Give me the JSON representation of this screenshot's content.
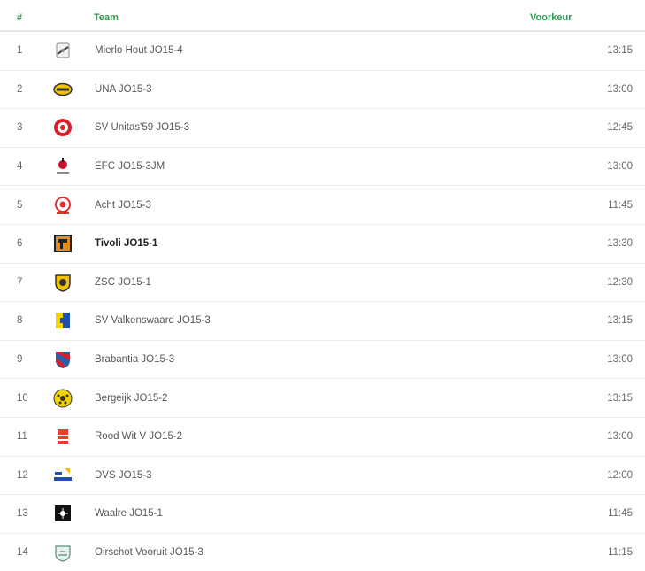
{
  "header": {
    "num": "#",
    "team": "Team",
    "preference": "Voorkeur"
  },
  "accent_color": "#2e9a4e",
  "rows": [
    {
      "num": "1",
      "team": "Mierlo Hout JO15-4",
      "time": "13:15",
      "logo": "mierlo-hout-logo"
    },
    {
      "num": "2",
      "team": "UNA JO15-3",
      "time": "13:00",
      "logo": "una-logo"
    },
    {
      "num": "3",
      "team": "SV Unitas'59 JO15-3",
      "time": "12:45",
      "logo": "unitas-logo"
    },
    {
      "num": "4",
      "team": "EFC JO15-3JM",
      "time": "13:00",
      "logo": "efc-logo"
    },
    {
      "num": "5",
      "team": "Acht JO15-3",
      "time": "11:45",
      "logo": "acht-logo"
    },
    {
      "num": "6",
      "team": "Tivoli JO15-1",
      "time": "13:30",
      "logo": "tivoli-logo",
      "highlight": true
    },
    {
      "num": "7",
      "team": "ZSC JO15-1",
      "time": "12:30",
      "logo": "zsc-logo"
    },
    {
      "num": "8",
      "team": "SV Valkenswaard JO15-3",
      "time": "13:15",
      "logo": "valkenswaard-logo"
    },
    {
      "num": "9",
      "team": "Brabantia JO15-3",
      "time": "13:00",
      "logo": "brabantia-logo"
    },
    {
      "num": "10",
      "team": "Bergeijk JO15-2",
      "time": "13:15",
      "logo": "bergeijk-logo"
    },
    {
      "num": "11",
      "team": "Rood Wit V JO15-2",
      "time": "13:00",
      "logo": "rood-wit-logo"
    },
    {
      "num": "12",
      "team": "DVS JO15-3",
      "time": "12:00",
      "logo": "dvs-logo"
    },
    {
      "num": "13",
      "team": "Waalre JO15-1",
      "time": "11:45",
      "logo": "waalre-logo"
    },
    {
      "num": "14",
      "team": "Oirschot Vooruit JO15-3",
      "time": "11:15",
      "logo": "oirschot-logo"
    }
  ]
}
